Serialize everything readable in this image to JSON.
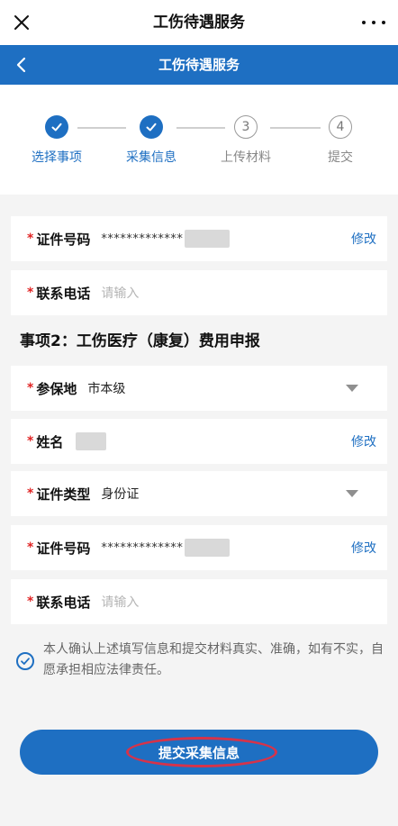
{
  "topbar": {
    "title": "工伤待遇服务"
  },
  "navbar": {
    "title": "工伤待遇服务"
  },
  "steps": [
    {
      "label": "选择事项",
      "state": "done"
    },
    {
      "label": "采集信息",
      "state": "done"
    },
    {
      "label": "上传材料",
      "state": "todo",
      "number": "3"
    },
    {
      "label": "提交",
      "state": "todo",
      "number": "4"
    }
  ],
  "form1": {
    "id_number": {
      "label": "证件号码",
      "value": "*************",
      "action": "修改"
    },
    "phone": {
      "label": "联系电话",
      "placeholder": "请输入"
    }
  },
  "section2": {
    "title": "事项2：工伤医疗（康复）费用申报"
  },
  "form2": {
    "insured_place": {
      "label": "参保地",
      "value": "市本级"
    },
    "name": {
      "label": "姓名",
      "action": "修改"
    },
    "id_type": {
      "label": "证件类型",
      "value": "身份证"
    },
    "id_number": {
      "label": "证件号码",
      "value": "*************",
      "action": "修改"
    },
    "phone": {
      "label": "联系电话",
      "placeholder": "请输入"
    }
  },
  "required_mark": "*",
  "consent": {
    "text": "本人确认上述填写信息和提交材料真实、准确，如有不实，自愿承担相应法律责任。"
  },
  "submit": {
    "label": "提交采集信息"
  },
  "colors": {
    "primary": "#1e6fc2",
    "required": "#e02424",
    "highlight": "#d6334a"
  }
}
